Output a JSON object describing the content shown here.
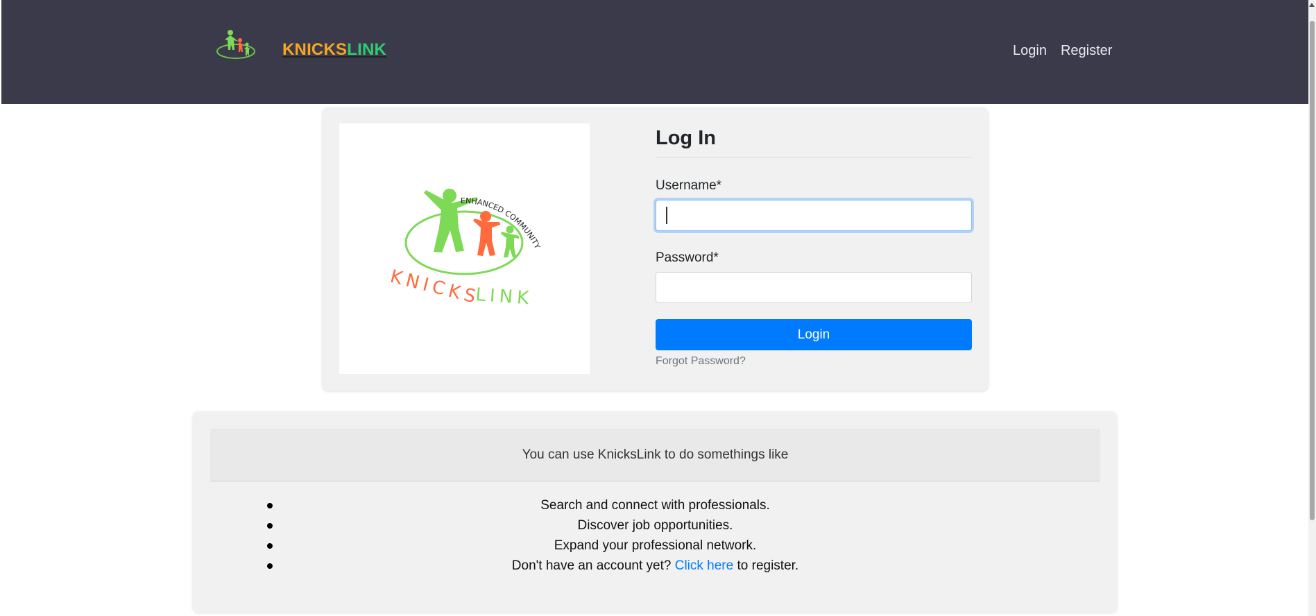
{
  "navbar": {
    "brand_part1": "KNICKS",
    "brand_part2": "LINK",
    "links": {
      "login": "Login",
      "register": "Register"
    }
  },
  "login": {
    "title": "Log In",
    "username_label": "Username*",
    "username_value": "",
    "password_label": "Password*",
    "password_value": "",
    "submit_label": "Login",
    "forgot_label": "Forgot Password?"
  },
  "logo": {
    "arc_text": "ENHANCED COMMUNITY",
    "word1": "KNICKS",
    "word2": "LINK"
  },
  "info": {
    "header": "You can use KnicksLink to do somethings like",
    "items": [
      "Search and connect with professionals.",
      "Discover job opportunities.",
      "Expand your professional network."
    ],
    "register_prefix": "Don't have an account yet? ",
    "register_link": "Click here",
    "register_suffix": " to register."
  },
  "colors": {
    "navbar_bg": "#3b3a4a",
    "brand_orange": "#f5a623",
    "brand_green": "#2ecc71",
    "primary_button": "#007bff",
    "logo_green": "#7ed957",
    "logo_orange": "#ff6b3d"
  }
}
